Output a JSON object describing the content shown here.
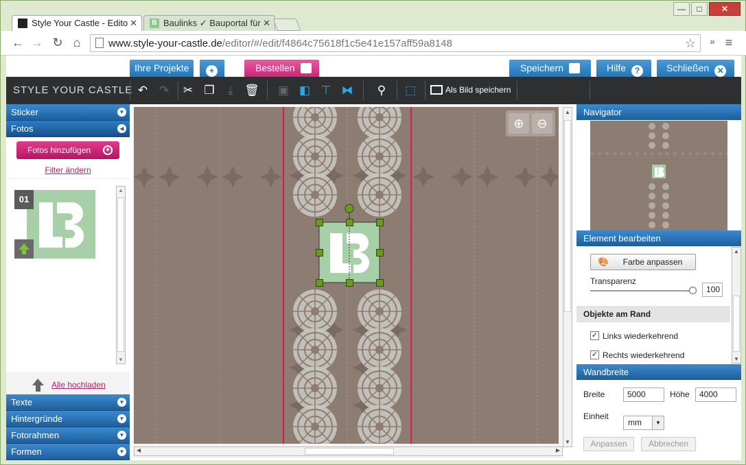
{
  "browser": {
    "tabs": [
      {
        "title": "Style Your Castle - Edito",
        "active": true
      },
      {
        "title": "Baulinks ✓ Bauportal für",
        "active": false
      }
    ],
    "url_host": "www.style-your-castle.de",
    "url_path": "/editor/#/edit/f4864c75618f1c5e41e157aff59a8148",
    "minimize": "—",
    "maximize": "□",
    "close": "✕",
    "more": "»",
    "menu": "≡"
  },
  "topstrip": {
    "projects": "Ihre Projekte",
    "order": "Bestellen",
    "save": "Speichern",
    "help": "Hilfe",
    "close": "Schließen"
  },
  "ribbon": {
    "logo": "STYLE YOUR CASTLE",
    "save_image": "Als Bild speichern"
  },
  "left": {
    "sections_top": [
      "Sticker",
      "Fotos"
    ],
    "add_photos": "Fotos hinzufügen",
    "filter": "Filter ändern",
    "thumb_number": "01",
    "upload_all": "Alle hochladen",
    "sections_bottom": [
      "Texte",
      "Hintergründe",
      "Fotorahmen",
      "Formen"
    ]
  },
  "right": {
    "navigator": "Navigator",
    "edit_element": "Element bearbeiten",
    "adjust_color": "Farbe anpassen",
    "transparency": "Transparenz",
    "transparency_value": "100",
    "edge_objects": "Objekte am Rand",
    "left_repeat": "Links wiederkehrend",
    "right_repeat": "Rechts wiederkehrend",
    "wall_width": "Wandbreite",
    "width_label": "Breite",
    "width_value": "5000",
    "height_label": "Höhe",
    "height_value": "4000",
    "unit_label": "Einheit",
    "unit_value": "mm",
    "apply": "Anpassen",
    "cancel": "Abbrechen"
  },
  "colors": {
    "wall": "#8d7c72",
    "accent_blue": "#2476b8",
    "accent_pink": "#c8287a",
    "guide_red": "#e0164a",
    "handle_green": "#6c9a1e"
  }
}
